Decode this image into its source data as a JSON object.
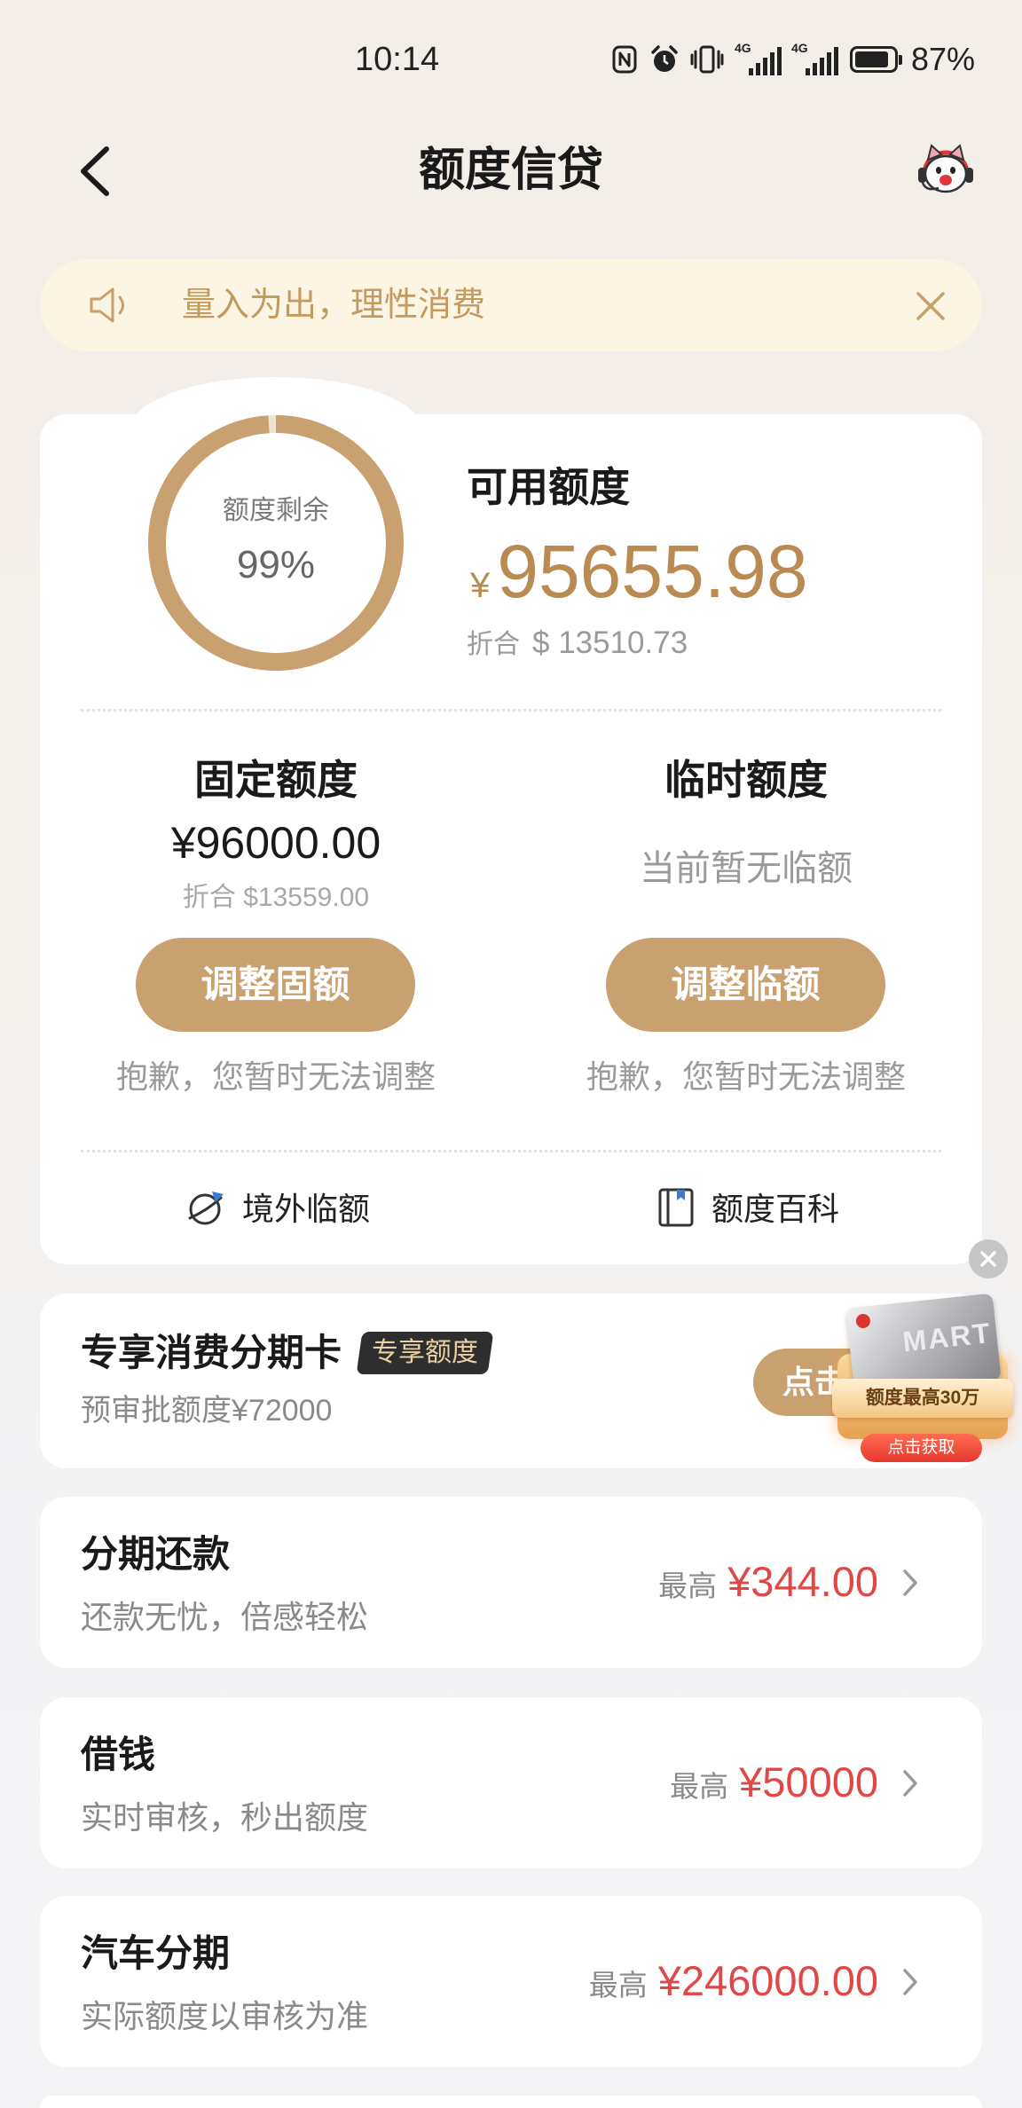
{
  "theme": {
    "accent": "#c9a170",
    "amount_gold": "#b98b52",
    "price_red": "#e04848",
    "notice_bg": "#fcf5e3",
    "notice_text": "#c49a5e"
  },
  "status_bar": {
    "time": "10:14",
    "network_1": "4G",
    "network_2": "4G",
    "battery": "87%",
    "battery_level": 0.87,
    "icons": [
      "nfc-icon",
      "alarm-icon",
      "vibrate-icon",
      "signal-icon",
      "signal-icon",
      "battery-icon"
    ]
  },
  "header": {
    "title": "额度信贷",
    "back_icon": "chevron-left-icon",
    "service_icon": "customer-service-mascot-icon"
  },
  "notice": {
    "icon": "speaker-icon",
    "text": "量入为出，理性消费",
    "close_icon": "close-icon"
  },
  "quota": {
    "ring_label": "额度剩余",
    "ring_percent": "99%",
    "ring_fraction": 0.99,
    "available_label": "可用额度",
    "currency_symbol": "¥",
    "available_amount": "95655.98",
    "equivalent_label": "折合",
    "equivalent_value": "$ 13510.73",
    "fixed": {
      "title": "固定额度",
      "amount": "¥96000.00",
      "equivalent": "折合 $13559.00",
      "button": "调整固额",
      "note": "抱歉，您暂时无法调整"
    },
    "temporary": {
      "title": "临时额度",
      "status": "当前暂无临额",
      "button": "调整临额",
      "note": "抱歉，您暂时无法调整"
    },
    "links": [
      {
        "label": "境外临额",
        "icon": "globe-plane-icon"
      },
      {
        "label": "额度百科",
        "icon": "book-icon"
      }
    ]
  },
  "installment_card": {
    "title": "专享消费分期卡",
    "badge": "专享额度",
    "subtitle": "预审批额度¥72000",
    "button": "点击",
    "promo": {
      "card_text": "MART",
      "ribbon": "额度最高30万",
      "cta": "点击获取",
      "close_icon": "close-circle-icon"
    }
  },
  "products": [
    {
      "title": "分期还款",
      "subtitle": "还款无忧，倍感轻松",
      "prefix": "最高",
      "amount": "¥344.00",
      "icon": "chevron-right-icon"
    },
    {
      "title": "借钱",
      "subtitle": "实时审核，秒出额度",
      "prefix": "最高",
      "amount": "¥50000",
      "icon": "chevron-right-icon"
    },
    {
      "title": "汽车分期",
      "subtitle": "实际额度以审核为准",
      "prefix": "最高",
      "amount": "¥246000.00",
      "icon": "chevron-right-icon"
    }
  ]
}
